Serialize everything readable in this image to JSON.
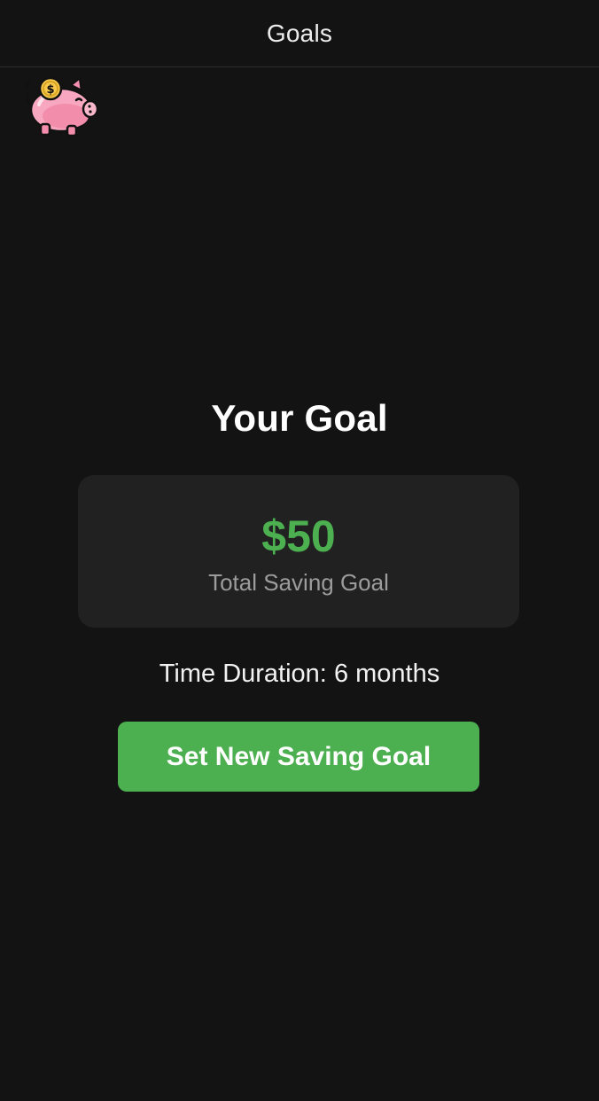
{
  "header": {
    "title": "Goals"
  },
  "logo": {
    "icon": "piggy-bank-icon"
  },
  "goal": {
    "heading": "Your Goal",
    "amount": "$50",
    "caption": "Total Saving Goal",
    "duration_label": "Time Duration:",
    "duration_value": "6 months"
  },
  "actions": {
    "set_new_goal_label": "Set New Saving Goal"
  },
  "colors": {
    "background": "#131313",
    "card": "#212121",
    "accent_green": "#4caf50",
    "muted_text": "#9c9c9c"
  }
}
